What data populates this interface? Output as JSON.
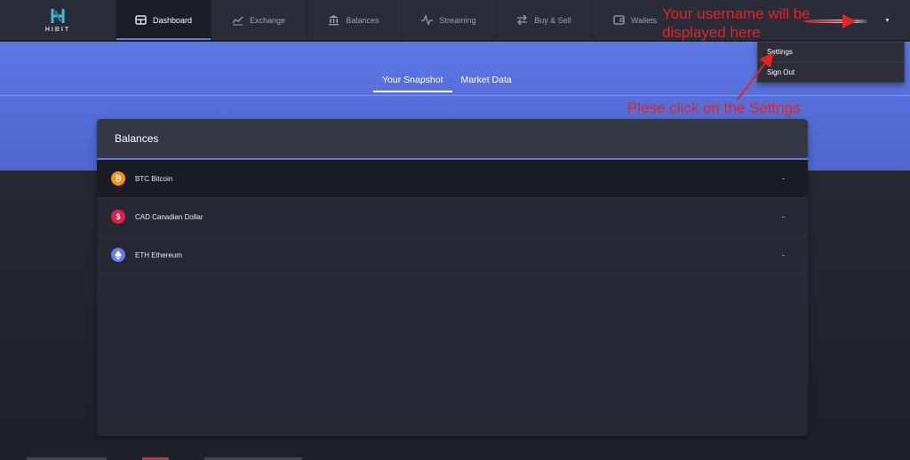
{
  "brand": {
    "name": "HIBIT"
  },
  "nav": {
    "items": [
      {
        "label": "Dashboard",
        "icon": "dashboard-icon",
        "active": true
      },
      {
        "label": "Exchange",
        "icon": "chart-line-icon"
      },
      {
        "label": "Balances",
        "icon": "bank-icon"
      },
      {
        "label": "Streaming",
        "icon": "pulse-icon"
      },
      {
        "label": "Buy & Sell",
        "icon": "swap-icon"
      },
      {
        "label": "Wallets",
        "icon": "wallet-icon"
      }
    ]
  },
  "subtabs": [
    {
      "label": "Your Snapshot",
      "active": true
    },
    {
      "label": "Market Data"
    }
  ],
  "balances": {
    "title": "Balances",
    "rows": [
      {
        "label": "BTC Bitcoin",
        "value": "-",
        "icon": "bitcoin-icon",
        "color": "#f7931a"
      },
      {
        "label": "CAD Canadian Dollar",
        "value": "-",
        "icon": "dollar-icon",
        "color": "#e0204a"
      },
      {
        "label": "ETH Ethereum",
        "value": "-",
        "icon": "ethereum-icon",
        "color": "#627eea"
      }
    ]
  },
  "dropdown": {
    "items": [
      {
        "label": "Settings"
      },
      {
        "label": "Sign Out"
      }
    ]
  },
  "annotations": {
    "username": "Your username will be displayed here",
    "settings": "Plese click on the Settngs"
  },
  "colors": {
    "accent": "#5c77e0",
    "annotation": "#e0242c",
    "nav_bg": "#2a2d37"
  }
}
